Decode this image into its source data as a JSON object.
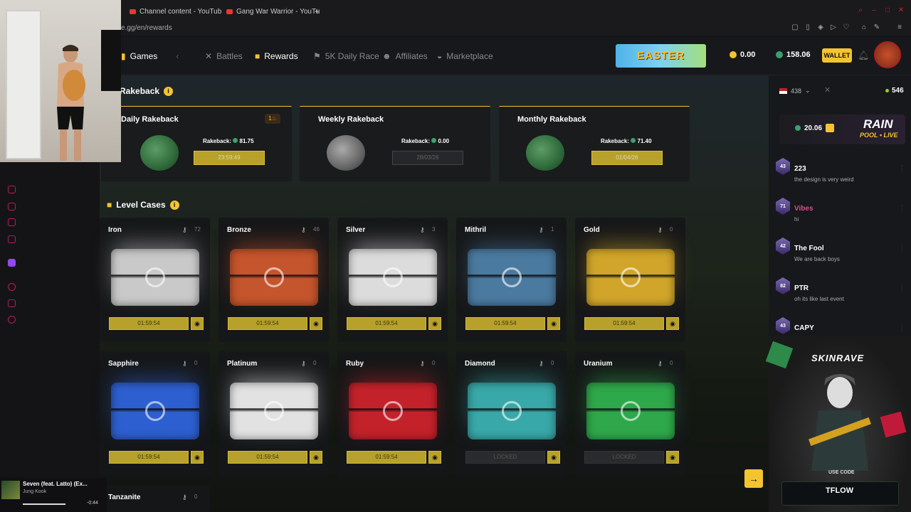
{
  "browser": {
    "tabs": [
      {
        "label": "Channel content - YouTub"
      },
      {
        "label": "Gang War Warrior - YouTu"
      }
    ],
    "new_tab": "+",
    "url": "e.gg/en/rewards"
  },
  "nav": {
    "games": "Games",
    "items": [
      {
        "label": "Battles"
      },
      {
        "label": "Rewards"
      },
      {
        "label": "5K Daily Race"
      },
      {
        "label": "Affiliates"
      },
      {
        "label": "Marketplace"
      }
    ],
    "event_banner": "EASTER",
    "coin_balance": "0.00",
    "gem_balance": "158.06",
    "wallet": "WALLET"
  },
  "rakeback": {
    "title": "Rakeback",
    "cards": [
      {
        "title": "Daily Rakeback",
        "label": "Rakeback:",
        "value": "81.75",
        "button": "23:59:49",
        "badge": "1",
        "enabled": true
      },
      {
        "title": "Weekly Rakeback",
        "label": "Rakeback:",
        "value": "0.00",
        "button": "28/03/26",
        "enabled": false
      },
      {
        "title": "Monthly Rakeback",
        "label": "Rakeback:",
        "value": "71.40",
        "button": "01/04/26",
        "enabled": true
      }
    ]
  },
  "level_cases": {
    "title": "Level Cases",
    "cases": [
      {
        "name": "Iron",
        "count": "72",
        "timer": "01:59:54",
        "color": "#c9c9c9"
      },
      {
        "name": "Bronze",
        "count": "46",
        "timer": "01:59:54",
        "color": "#c5552c"
      },
      {
        "name": "Silver",
        "count": "3",
        "timer": "01:59:54",
        "color": "#dcdcdc"
      },
      {
        "name": "Mithril",
        "count": "1",
        "timer": "01:59:54",
        "color": "#4b7aa0"
      },
      {
        "name": "Gold",
        "count": "0",
        "timer": "01:59:54",
        "color": "#d1a52a"
      },
      {
        "name": "Sapphire",
        "count": "0",
        "timer": "01:59:54",
        "color": "#2d5fd0"
      },
      {
        "name": "Platinum",
        "count": "0",
        "timer": "01:59:54",
        "color": "#e2e2e2"
      },
      {
        "name": "Ruby",
        "count": "0",
        "timer": "01:59:54",
        "color": "#c4222b"
      },
      {
        "name": "Diamond",
        "count": "0",
        "timer": "LOCKED",
        "color": "#38a8a8"
      },
      {
        "name": "Uranium",
        "count": "0",
        "timer": "LOCKED",
        "color": "#2ea84a"
      },
      {
        "name": "Tanzanite",
        "count": "0"
      }
    ]
  },
  "chat": {
    "online": "438",
    "points": "546",
    "rain": {
      "amount": "20.06",
      "title": "RAIN",
      "subtitle": "POOL • LIVE"
    },
    "messages": [
      {
        "level": "43",
        "name": "223",
        "text": "the design is very weird",
        "color": "#ffffff"
      },
      {
        "level": "71",
        "name": "Vibes",
        "text": "hi",
        "color": "#e04a8a"
      },
      {
        "level": "42",
        "name": "The Fool",
        "text": "We are back boys",
        "color": "#ffffff"
      },
      {
        "level": "82",
        "name": "PTR",
        "text": "oh its like last event",
        "color": "#ffffff"
      },
      {
        "level": "43",
        "name": "CAPY",
        "text": "",
        "color": "#ffffff"
      }
    ],
    "promo": {
      "brand": "SKINRAVE",
      "use_code": "USE CODE",
      "code": "TFLOW"
    }
  },
  "music": {
    "title": "Seven (feat. Latto) (Ex...",
    "artist": "Jung Kook",
    "time": "-0:44"
  }
}
